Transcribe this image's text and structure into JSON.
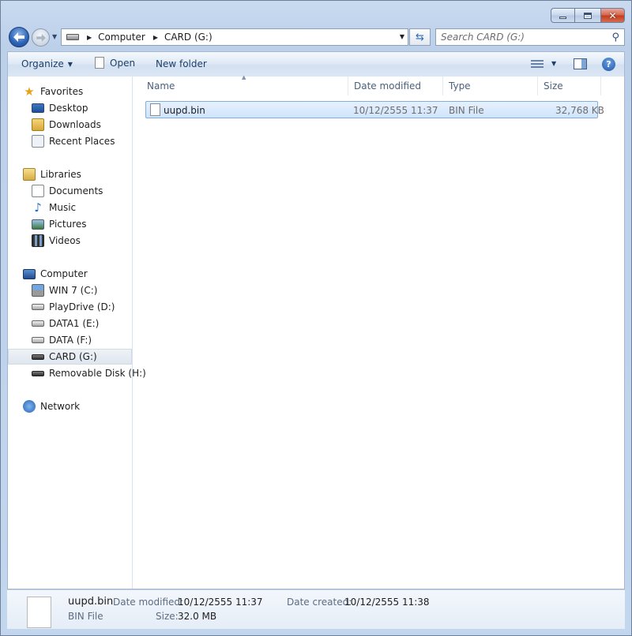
{
  "window": {
    "caption": {
      "minimize": "minimize",
      "maximize": "maximize",
      "close": "close"
    }
  },
  "address": {
    "crumbs": [
      "Computer",
      "CARD (G:)"
    ]
  },
  "search": {
    "placeholder": "Search CARD (G:)"
  },
  "toolbar": {
    "organize_label": "Organize",
    "open_label": "Open",
    "new_folder_label": "New folder"
  },
  "nav": {
    "favorites": {
      "label": "Favorites",
      "items": [
        "Desktop",
        "Downloads",
        "Recent Places"
      ]
    },
    "libraries": {
      "label": "Libraries",
      "items": [
        "Documents",
        "Music",
        "Pictures",
        "Videos"
      ]
    },
    "computer": {
      "label": "Computer",
      "items": [
        "WIN 7 (C:)",
        "PlayDrive (D:)",
        "DATA1 (E:)",
        "DATA (F:)",
        "CARD (G:)",
        "Removable Disk (H:)"
      ]
    },
    "network": {
      "label": "Network"
    },
    "selected": "CARD (G:)"
  },
  "columns": [
    "Name",
    "Date modified",
    "Type",
    "Size"
  ],
  "files": [
    {
      "name": "uupd.bin",
      "date_modified": "10/12/2555 11:37",
      "type": "BIN File",
      "size": "32,768 KB"
    }
  ],
  "details": {
    "name": "uupd.bin",
    "type": "BIN File",
    "date_modified_label": "Date modified:",
    "date_modified": "10/12/2555 11:37",
    "date_created_label": "Date created:",
    "date_created": "10/12/2555 11:38",
    "size_label": "Size:",
    "size": "32.0 MB"
  }
}
